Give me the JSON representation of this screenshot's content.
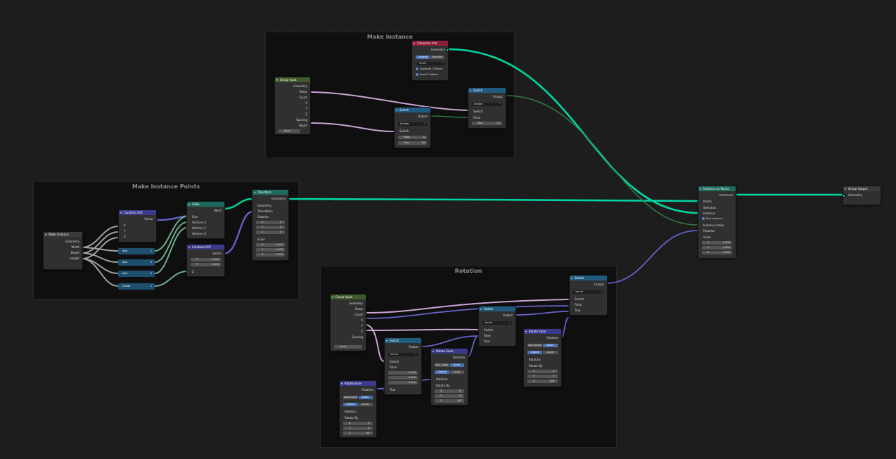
{
  "frames": {
    "make_instance": "Make Instance",
    "make_instance_points": "Make Instance Points",
    "rotation": "Rotation"
  },
  "colors": {
    "geometry_wire": "#00d6a3",
    "vector_wire": "#6363c7",
    "bool_wire": "#cca6d6",
    "int_wire": "#35824a",
    "float_wire": "#a1a1a1"
  },
  "collection_info": {
    "title": "Collection Info",
    "geometry": "Geometry",
    "seg": [
      "Original",
      "Relative"
    ],
    "collection": "Stairs",
    "separate": "Separate Children",
    "reset": "Reset Children"
  },
  "group_in_top": {
    "title": "Group Input",
    "outputs": [
      "Geometry",
      "Steps",
      "Count",
      "X",
      "Y",
      "Z",
      "Spacing",
      "Depth"
    ],
    "footer": "Input"
  },
  "switch_top1": {
    "title": "Switch",
    "output": "Output",
    "type": "Integer",
    "switch": "Switch",
    "false": "False",
    "false_v": "8",
    "true": "True",
    "true_v": "16"
  },
  "switch_top2": {
    "title": "Switch",
    "output": "Output",
    "type": "Integer",
    "switch": "Switch",
    "false": "False",
    "true": "True",
    "true_v": "23"
  },
  "instance_on_points": {
    "title": "Instance on Points",
    "out": "Instances",
    "inputs": [
      "Points",
      "Selection",
      "Instance",
      "Pick Instance",
      "Instance Index",
      "Rotation",
      "Scale"
    ],
    "scale": [
      [
        "X",
        "1.000"
      ],
      [
        "Y",
        "1.000"
      ],
      [
        "Z",
        "1.000"
      ]
    ]
  },
  "group_output": {
    "title": "Group Output",
    "geometry": "Geometry"
  },
  "make_instance_node": {
    "title": "Make Instance",
    "outputs": [
      "Geometry",
      "Width",
      "Depth",
      "Height"
    ]
  },
  "combine_xyz1": {
    "title": "Combine XYZ",
    "vector": "Vector",
    "inputs": [
      "X",
      "Y",
      "Z"
    ]
  },
  "math_nodes": [
    {
      "title": "Add",
      "value": "1"
    },
    {
      "title": "Add",
      "value": "0"
    },
    {
      "title": "Add",
      "value": "0"
    },
    {
      "title": "Divide",
      "value": "2"
    }
  ],
  "cube": {
    "title": "Cube",
    "mesh": "Mesh",
    "inputs": [
      "Size",
      "Vertices X",
      "Vertices Y",
      "Vertices Z"
    ]
  },
  "combine_xyz2": {
    "title": "Combine XYZ",
    "vector": "Vector",
    "x": "0.000",
    "y": "0.000",
    "z": "Z"
  },
  "transform": {
    "title": "Transform",
    "geometry": "Geometry",
    "translation": "Translation",
    "rotation": "Rotation",
    "rot": [
      [
        "X",
        "0°"
      ],
      [
        "Y",
        "0°"
      ],
      [
        "Z",
        "0°"
      ]
    ],
    "scale_lbl": "Scale",
    "scale": [
      [
        "X",
        "1.000"
      ],
      [
        "Y",
        "1.000"
      ],
      [
        "Z",
        "1.000"
      ]
    ]
  },
  "group_in_rot": {
    "title": "Group Input",
    "outputs": [
      "Geometry",
      "Steps",
      "Count",
      "X",
      "Y",
      "Z",
      "Spacing",
      "Depth"
    ],
    "footer": "Input"
  },
  "switch_rot1": {
    "title": "Switch",
    "output": "Output",
    "type": "Vector",
    "switch": "Switch",
    "false": "False",
    "vals": [
      "0.000",
      "0.000",
      "0.000"
    ],
    "true": "True"
  },
  "switch_rot2": {
    "title": "Switch",
    "output": "Output",
    "type": "Vector",
    "switch": "Switch",
    "false": "False",
    "true": "True"
  },
  "switch_rot3": {
    "title": "Switch",
    "output": "Output",
    "type": "Vector",
    "switch": "Switch",
    "false": "False",
    "true": "True"
  },
  "rotate_euler1": {
    "title": "Rotate Euler",
    "rotation": "Rotation",
    "seg1": [
      "Axis Angle",
      "Euler"
    ],
    "seg2": [
      "Object",
      "Local"
    ],
    "rot_in": "Rotation",
    "rotate_by": "Rotate By",
    "vals": [
      [
        "X",
        "0°"
      ],
      [
        "Y",
        "0°"
      ],
      [
        "Z",
        "90°"
      ]
    ]
  },
  "rotate_euler2": {
    "title": "Rotate Euler",
    "rotation": "Rotation",
    "seg1": [
      "Axis Angle",
      "Euler"
    ],
    "seg2": [
      "Object",
      "Local"
    ],
    "rot_in": "Rotation",
    "rotate_by": "Rotate By",
    "vals": [
      [
        "X",
        "0°"
      ],
      [
        "Y",
        "0°"
      ],
      [
        "Z",
        "90°"
      ]
    ]
  },
  "rotate_euler3": {
    "title": "Rotate Euler",
    "rotation": "Rotation",
    "seg1": [
      "Axis Angle",
      "Euler"
    ],
    "seg2": [
      "Object",
      "Local"
    ],
    "rot_in": "Rotation",
    "rotate_by": "Rotate By",
    "vals": [
      [
        "X",
        "0°"
      ],
      [
        "Y",
        "0°"
      ],
      [
        "Z",
        "180°"
      ]
    ]
  }
}
